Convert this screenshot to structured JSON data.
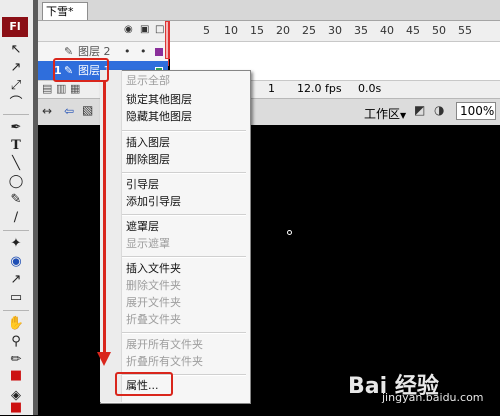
{
  "app": {
    "logo": "Fl"
  },
  "document": {
    "tab": "下雪*"
  },
  "timeline": {
    "frame_numbers": [
      "5",
      "10",
      "15",
      "20",
      "25",
      "30",
      "35",
      "40",
      "45",
      "50",
      "55"
    ],
    "layers": [
      {
        "name": "图层 2",
        "icon": "pencil-icon"
      },
      {
        "name": "图层 1",
        "icon": "pencil-icon",
        "number": "1"
      }
    ],
    "footer": {
      "frame": "1",
      "fps": "12.0 fps",
      "time": "0.0s"
    }
  },
  "editbar": {
    "workspace": "工作区",
    "zoom": "100%"
  },
  "context_menu": {
    "items": [
      {
        "label": "显示全部",
        "enabled": false
      },
      {
        "label": "锁定其他图层",
        "enabled": true
      },
      {
        "label": "隐藏其他图层",
        "enabled": true
      },
      {
        "label": "插入图层",
        "enabled": true
      },
      {
        "label": "删除图层",
        "enabled": true
      },
      {
        "label": "引导层",
        "enabled": true
      },
      {
        "label": "添加引导层",
        "enabled": true
      },
      {
        "label": "遮罩层",
        "enabled": true
      },
      {
        "label": "显示遮罩",
        "enabled": false
      },
      {
        "label": "插入文件夹",
        "enabled": true
      },
      {
        "label": "删除文件夹",
        "enabled": false
      },
      {
        "label": "展开文件夹",
        "enabled": false
      },
      {
        "label": "折叠文件夹",
        "enabled": false
      },
      {
        "label": "展开所有文件夹",
        "enabled": false
      },
      {
        "label": "折叠所有文件夹",
        "enabled": false
      },
      {
        "label": "属性...",
        "enabled": true
      }
    ]
  },
  "watermark": {
    "brand": "Bai 经验",
    "url": "jingyan.baidu.com"
  },
  "colors": {
    "accent_red": "#d9261c",
    "selection_blue": "#2f6edc",
    "logo_red": "#8b0f16"
  }
}
